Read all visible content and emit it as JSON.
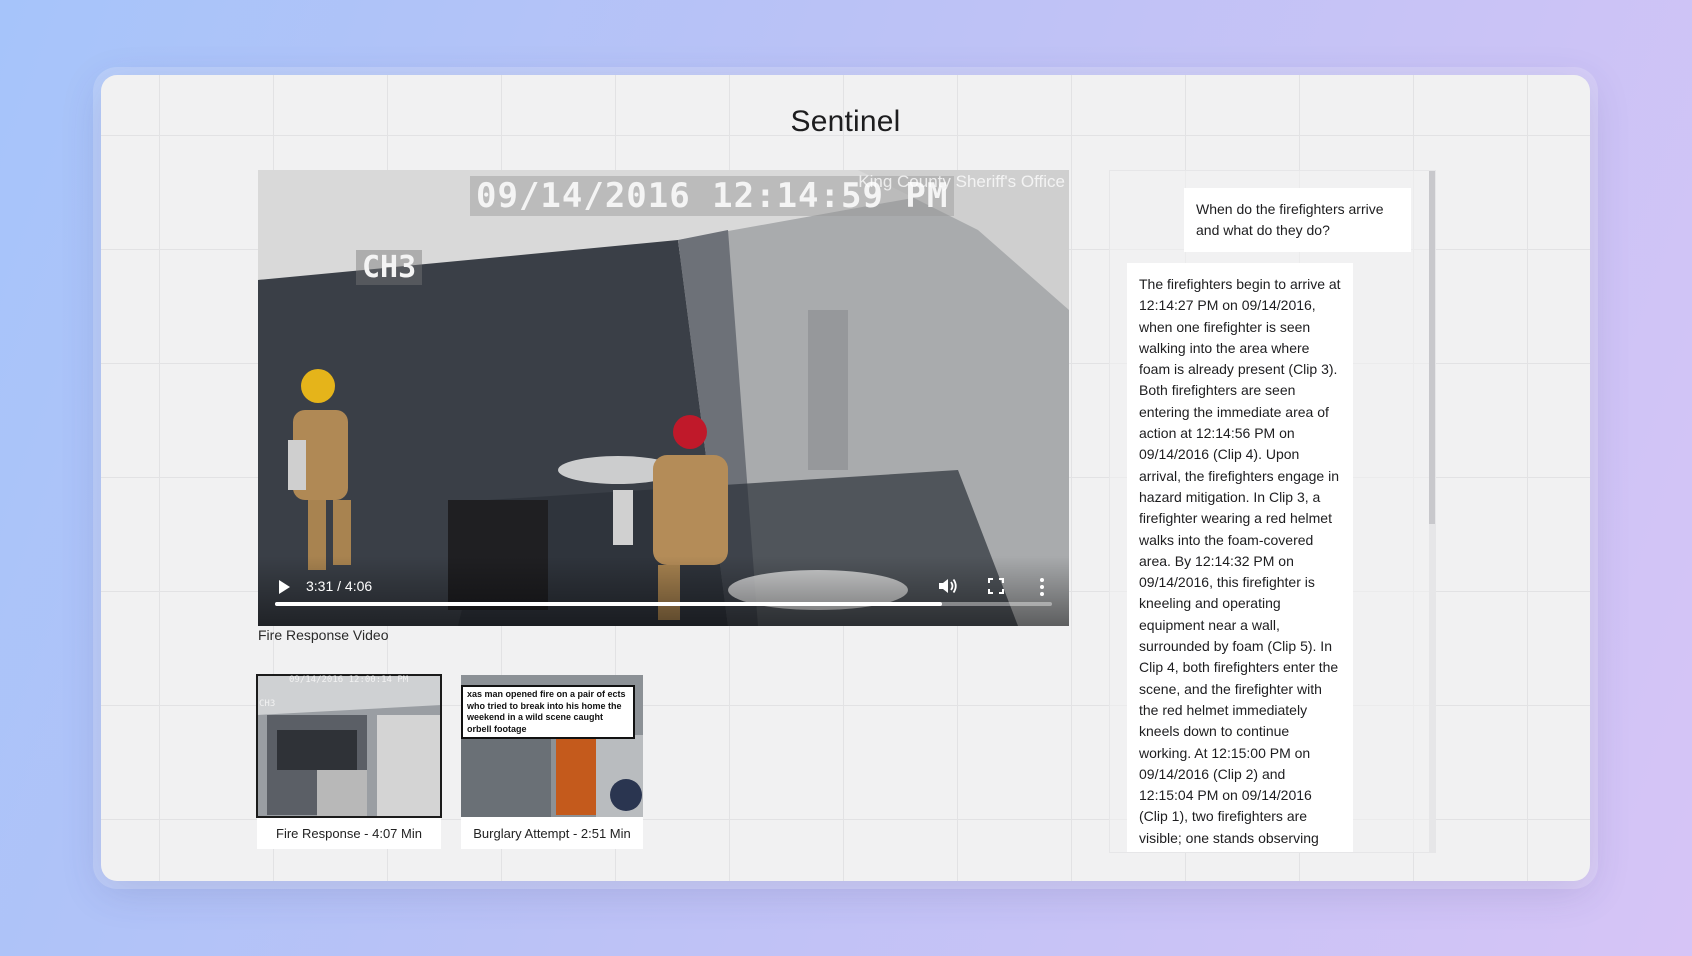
{
  "app": {
    "title": "Sentinel"
  },
  "video": {
    "osd_timestamp": "09/14/2016 12:14:59 PM",
    "osd_channel": "CH3",
    "watermark": "King County Sheriff's Office",
    "time_display": "3:31 / 4:06",
    "progress": 0.858,
    "caption": "Fire Response Video"
  },
  "thumbnails": [
    {
      "label": "Fire Response - 4:07 Min",
      "overlay_timestamp": "09/14/2016 12:00:14 PM",
      "overlay_channel": "CH3",
      "selected": true
    },
    {
      "label": "Burglary Attempt - 2:51 Min",
      "news_caption": "xas man opened fire on a pair of ects who tried to break into his home the weekend in a wild scene caught orbell footage",
      "selected": false
    }
  ],
  "chat": {
    "user_message": "When do the firefighters arrive and what do they do?",
    "assistant_message": "The firefighters begin to arrive at 12:14:27 PM on 09/14/2016, when one firefighter is seen walking into the area where foam is already present (Clip 3). Both firefighters are seen entering the immediate area of action at 12:14:56 PM on 09/14/2016 (Clip 4). Upon arrival, the firefighters engage in hazard mitigation. In Clip 3, a firefighter wearing a red helmet walks into the foam-covered area. By 12:14:32 PM on 09/14/2016, this firefighter is kneeling and operating equipment near a wall, surrounded by foam (Clip 5). In Clip 4, both firefighters enter the scene, and the firefighter with the red helmet immediately kneels down to continue working. At 12:15:00 PM on 09/14/2016 (Clip 2) and 12:15:04 PM on 09/14/2016 (Clip 1), two firefighters are visible; one stands observing"
  },
  "icons": {
    "play": "play-icon",
    "volume": "volume-icon",
    "fullscreen": "fullscreen-icon",
    "menu": "more-vertical-icon"
  }
}
